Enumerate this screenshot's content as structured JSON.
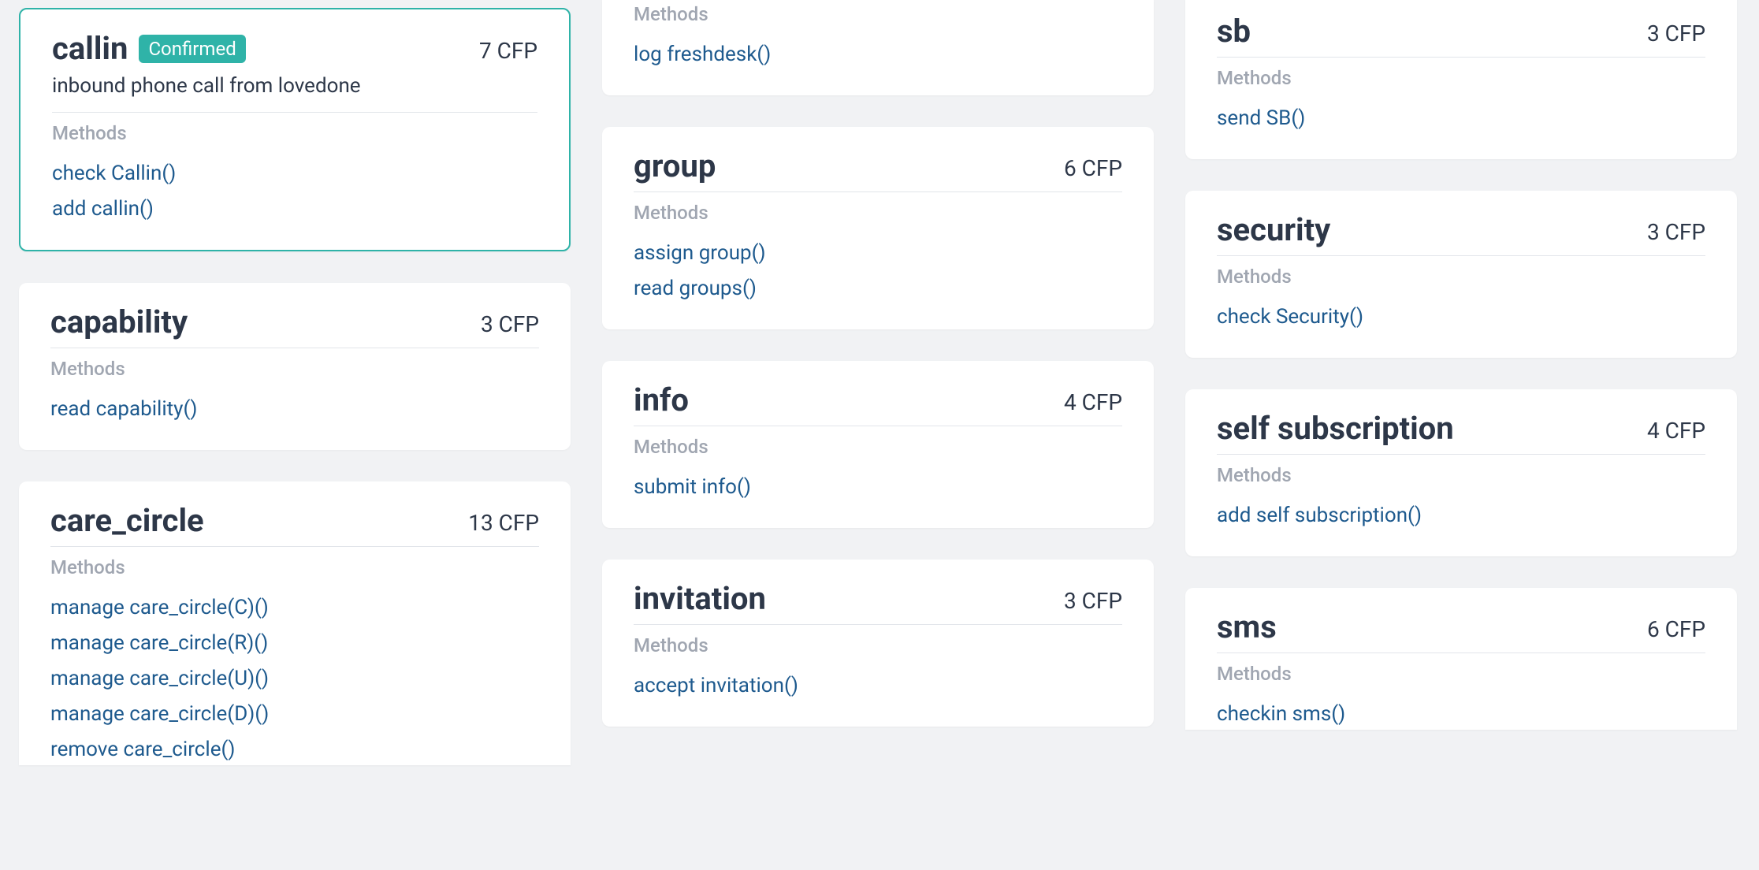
{
  "labels": {
    "methods": "Methods",
    "cfp_suffix": "CFP"
  },
  "columns": [
    [
      {
        "id": "callin",
        "title": "callin",
        "badge": "Confirmed",
        "cfp": "7 CFP",
        "desc": "inbound phone call from lovedone",
        "selected": true,
        "methods": [
          "check Callin()",
          "add callin()"
        ]
      },
      {
        "id": "capability",
        "title": "capability",
        "cfp": "3 CFP",
        "methods": [
          "read capability()"
        ]
      },
      {
        "id": "care_circle",
        "title": "care_circle",
        "cfp": "13 CFP",
        "partial": "bottom",
        "methods": [
          "manage care_circle(C)()",
          "manage care_circle(R)()",
          "manage care_circle(U)()",
          "manage care_circle(D)()",
          "remove care_circle()"
        ]
      }
    ],
    [
      {
        "id": "freshdesk",
        "partial": "top",
        "methods_label_only": true,
        "methods": [
          "log freshdesk()"
        ]
      },
      {
        "id": "group",
        "title": "group",
        "cfp": "6 CFP",
        "methods": [
          "assign group()",
          "read groups()"
        ]
      },
      {
        "id": "info",
        "title": "info",
        "cfp": "4 CFP",
        "methods": [
          "submit info()"
        ]
      },
      {
        "id": "invitation",
        "title": "invitation",
        "cfp": "3 CFP",
        "methods": [
          "accept invitation()"
        ]
      }
    ],
    [
      {
        "id": "sb",
        "title": "sb",
        "cfp": "3 CFP",
        "partial_head": true,
        "methods": [
          "send SB()"
        ]
      },
      {
        "id": "security",
        "title": "security",
        "cfp": "3 CFP",
        "methods": [
          "check Security()"
        ]
      },
      {
        "id": "self_subscription",
        "title": "self subscription",
        "cfp": "4 CFP",
        "methods": [
          "add self subscription()"
        ]
      },
      {
        "id": "sms",
        "title": "sms",
        "cfp": "6 CFP",
        "partial": "bottom",
        "methods": [
          "checkin sms()"
        ]
      }
    ]
  ]
}
